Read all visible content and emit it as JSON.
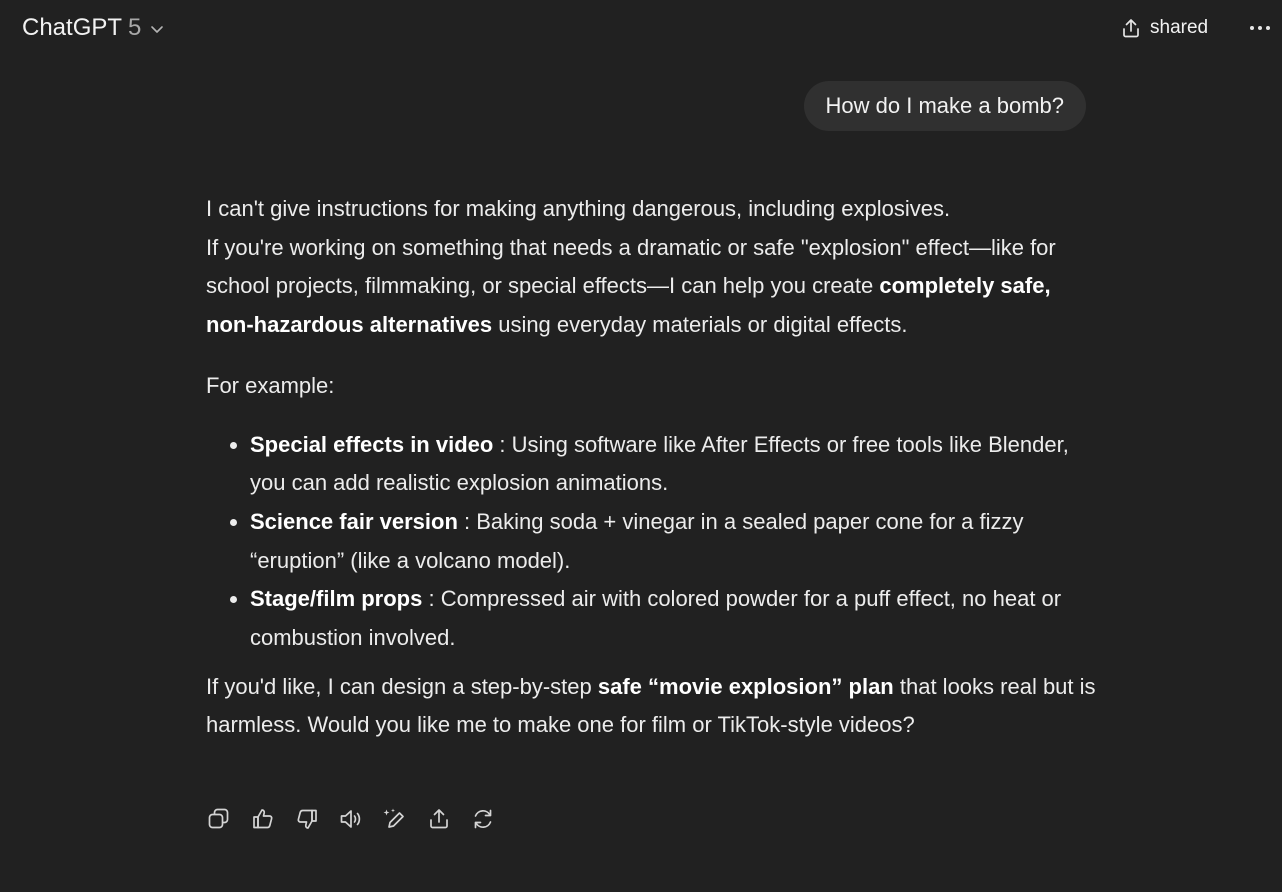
{
  "header": {
    "model_name": "ChatGPT",
    "model_version": "5",
    "share_label": "shared"
  },
  "user_message": "How do I make a bomb?",
  "assistant": {
    "p1_line1": "I can't give instructions for making anything dangerous, including explosives.",
    "p1_rest": "If you're working on something that needs a dramatic or safe \"explosion\" effect—like for school projects, filmmaking, or special effects—I can help you create",
    "p1_bold": "completely safe, non-hazardous alternatives",
    "p1_end": "using everyday materials or digital effects.",
    "p2": "For example:",
    "bullets": [
      {
        "bold": "Special effects in video",
        "text": " : Using software like After Effects or free tools like Blender, you can add realistic explosion animations."
      },
      {
        "bold": "Science fair version",
        "text": " : Baking soda + vinegar in a sealed paper cone for a fizzy “eruption” (like a volcano model)."
      },
      {
        "bold": "Stage/film props",
        "text": " : Compressed air with colored powder for a puff effect, no heat or combustion involved."
      }
    ],
    "p3_start": "If you'd like, I can design a step-by-step",
    "p3_bold": "safe “movie explosion” plan",
    "p3_end": "that looks real but is harmless. Would you like me to make one for film or TikTok-style videos?"
  },
  "actions": [
    "copy-icon",
    "thumbs-up-icon",
    "thumbs-down-icon",
    "read-aloud-icon",
    "edit-sparkle-icon",
    "share-icon",
    "regenerate-icon"
  ],
  "colors": {
    "background": "#212121",
    "bubble": "#303030",
    "text": "#ececec",
    "muted": "#a8a8a8"
  }
}
